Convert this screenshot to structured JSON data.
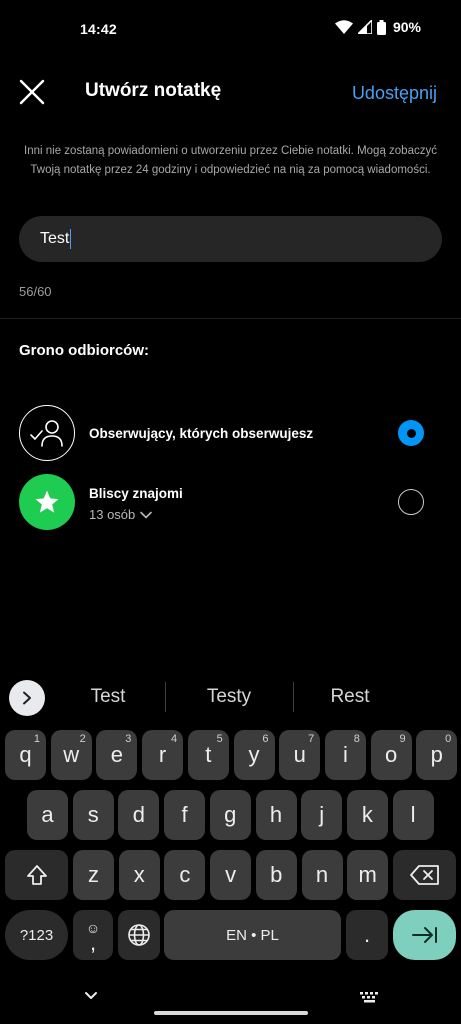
{
  "status_bar": {
    "time": "14:42",
    "battery": "90%"
  },
  "header": {
    "title": "Utwórz notatkę",
    "share_label": "Udostępnij"
  },
  "info_text": "Inni nie zostaną powiadomieni o utworzeniu przez Ciebie notatki. Mogą zobaczyć Twoją notatkę przez 24 godziny i odpowiedzieć na nią za pomocą wiadomości.",
  "note": {
    "value": "Test",
    "char_count": "56/60"
  },
  "audience": {
    "label": "Grono odbiorców:",
    "options": [
      {
        "title": "Obserwujący, których obserwujesz",
        "selected": true,
        "icon": "mutual-followers-icon"
      },
      {
        "title": "Bliscy znajomi",
        "subtitle": "13 osób",
        "selected": false,
        "icon": "star-icon"
      }
    ]
  },
  "keyboard": {
    "suggestions": [
      "Test",
      "Testy",
      "Rest"
    ],
    "row1": [
      {
        "k": "q",
        "h": "1"
      },
      {
        "k": "w",
        "h": "2"
      },
      {
        "k": "e",
        "h": "3"
      },
      {
        "k": "r",
        "h": "4"
      },
      {
        "k": "t",
        "h": "5"
      },
      {
        "k": "y",
        "h": "6"
      },
      {
        "k": "u",
        "h": "7"
      },
      {
        "k": "i",
        "h": "8"
      },
      {
        "k": "o",
        "h": "9"
      },
      {
        "k": "p",
        "h": "0"
      }
    ],
    "row2": [
      "a",
      "s",
      "d",
      "f",
      "g",
      "h",
      "j",
      "k",
      "l"
    ],
    "row3": [
      "z",
      "x",
      "c",
      "v",
      "b",
      "n",
      "m"
    ],
    "symbols_label": "?123",
    "comma_label": ",",
    "space_label": "EN • PL",
    "period_label": ".",
    "enter_color": "#7fcfbf"
  }
}
